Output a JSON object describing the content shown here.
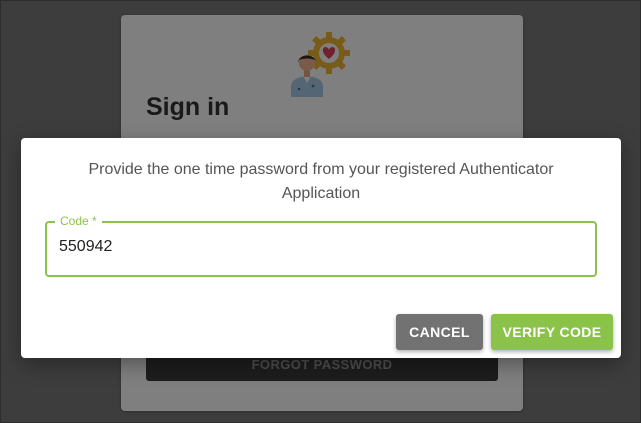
{
  "background_card": {
    "title": "Sign in",
    "forgot_password_label": "FORGOT PASSWORD",
    "logo_icon": "doctor-gear-heart-icon"
  },
  "dialog": {
    "message": "Provide the one time password from your registered Authenticator Application",
    "code_field": {
      "label": "Code *",
      "value": "550942"
    },
    "cancel_label": "CANCEL",
    "verify_label": "VERIFY CODE"
  },
  "colors": {
    "accent": "#8bc34a",
    "cancel": "#727272",
    "overlay": "rgba(0,0,0,0.5)"
  }
}
